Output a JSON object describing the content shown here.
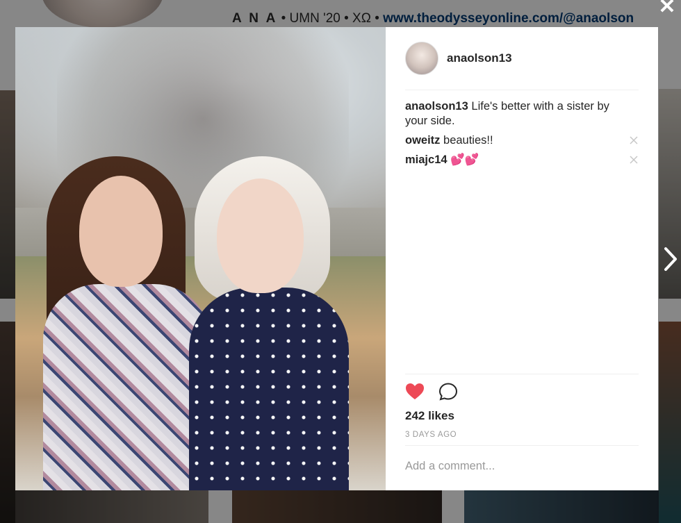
{
  "profile_bio": {
    "name": "A N A",
    "details": "• UMN '20 • XΩ •",
    "link": "www.theodysseyonline.com/@anaolson"
  },
  "controls": {
    "close": "✕"
  },
  "post": {
    "username": "anaolson13",
    "comments": [
      {
        "user": "anaolson13",
        "text": "Life's better with a sister by your side."
      },
      {
        "user": "oweitz",
        "text": "beauties!!"
      },
      {
        "user": "miajc14",
        "text": "💕💕"
      }
    ],
    "like_icon": "heart-icon",
    "comment_icon": "comment-icon",
    "liked": true,
    "likes": "242 likes",
    "time": "3 DAYS AGO",
    "comment_placeholder": "Add a comment..."
  },
  "colors": {
    "heart": "#ed4956",
    "link": "#003569",
    "text": "#262626",
    "muted": "#999999"
  }
}
